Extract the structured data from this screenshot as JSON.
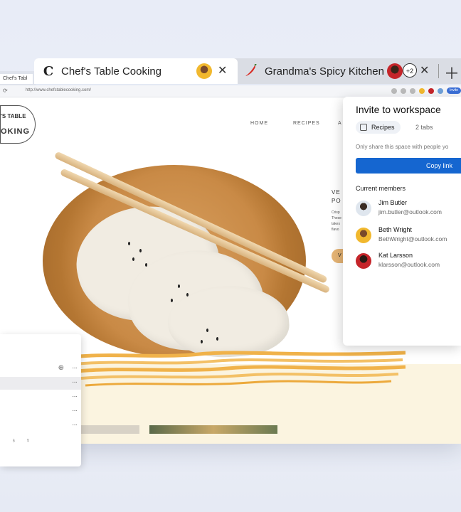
{
  "browser": {
    "mini_tab_label": "Chef's Tabl",
    "url": "http://www.chefstablecooking.com/",
    "invite_pill": "Invite",
    "tabs": [
      {
        "title": "Chef's Table Cooking",
        "favicon": "C"
      },
      {
        "title": "Grandma's Spicy Kitchen",
        "favicon": "chili-icon",
        "extra_count": "+2"
      }
    ],
    "colors": {
      "accent": "#1566d0",
      "tabstrip": "#dadde4"
    }
  },
  "webpage": {
    "logo_top": "'S TABLE",
    "logo_bottom": "OKING",
    "nav": [
      "HOME",
      "RECIPES",
      "A"
    ],
    "side_heading": "VE",
    "side_heading2": "PO",
    "side_body": [
      "Crisp",
      "These",
      "takes",
      "flavo"
    ],
    "cta": "V"
  },
  "invite_panel": {
    "title": "Invite to workspace",
    "workspace_name": "Recipes",
    "tab_count": "2 tabs",
    "share_note": "Only share this space with people yo",
    "copy_button": "Copy link",
    "members_heading": "Current members",
    "members": [
      {
        "name": "Jim Butler",
        "email": "jim.butler@outlook.com",
        "avatar_color": "#dfe6ee"
      },
      {
        "name": "Beth Wright",
        "email": "BethWright@outlook.com",
        "avatar_color": "#f1b82e"
      },
      {
        "name": "Kat Larsson",
        "email": "klarsson@outlook.com",
        "avatar_color": "#c5252a"
      }
    ]
  }
}
